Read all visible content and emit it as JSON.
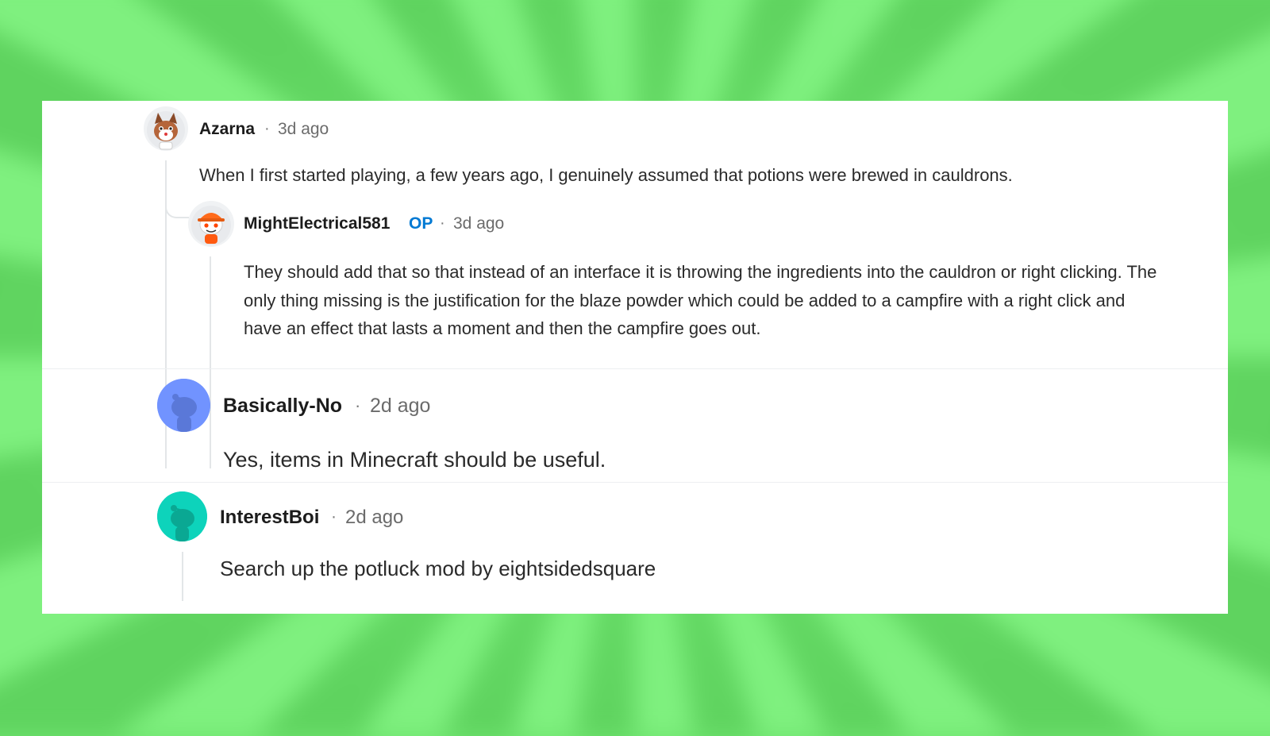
{
  "comments": [
    {
      "username": "Azarna",
      "separator": "·",
      "time": "3d ago",
      "text": "When I first started playing, a few years ago, I genuinely assumed that potions were brewed in cauldrons.",
      "avatar_icon": "snoo-cat-avatar-icon"
    },
    {
      "username": "MightElectrical581",
      "badge": "OP",
      "separator": "·",
      "time": "3d ago",
      "text": "They should add that so that instead of an interface it is throwing the ingredients into the cauldron or right clicking. The only thing missing is the justification for the blaze powder which could be added to a campfire with a right click and have an effect that lasts a moment and then the campfire goes out.",
      "avatar_icon": "snoo-cap-avatar-icon"
    },
    {
      "username": "Basically-No",
      "separator": "·",
      "time": "2d ago",
      "text": "Yes, items in Minecraft should be useful.",
      "avatar_icon": "default-snoo-avatar-icon",
      "avatar_color": "#7193ff"
    },
    {
      "username": "InterestBoi",
      "separator": "·",
      "time": "2d ago",
      "text": "Search up the potluck mod by eightsidedsquare",
      "avatar_icon": "default-snoo-avatar-icon",
      "avatar_color": "#0dd3bb"
    }
  ],
  "colors": {
    "op_badge": "#0079d3",
    "background": "#6ee36e"
  }
}
